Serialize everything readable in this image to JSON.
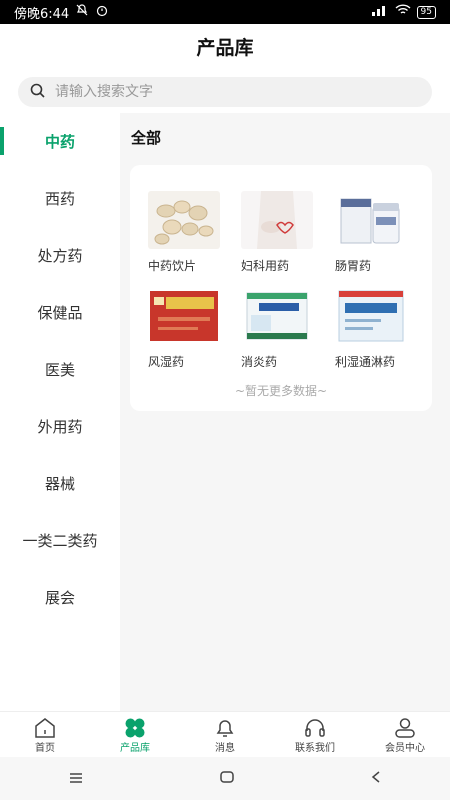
{
  "status_bar": {
    "time": "傍晚6:44",
    "network": "4G",
    "battery": "95"
  },
  "header": {
    "title": "产品库"
  },
  "search": {
    "placeholder": "请输入搜索文字"
  },
  "sidebar": {
    "items": [
      {
        "label": "中药",
        "active": true
      },
      {
        "label": "西药",
        "active": false
      },
      {
        "label": "处方药",
        "active": false
      },
      {
        "label": "保健品",
        "active": false
      },
      {
        "label": "医美",
        "active": false
      },
      {
        "label": "外用药",
        "active": false
      },
      {
        "label": "器械",
        "active": false
      },
      {
        "label": "一类二类药",
        "active": false
      },
      {
        "label": "展会",
        "active": false
      }
    ]
  },
  "main": {
    "section_title": "全部",
    "products": [
      {
        "label": "中药饮片"
      },
      {
        "label": "妇科用药"
      },
      {
        "label": "肠胃药"
      },
      {
        "label": "风湿药"
      },
      {
        "label": "消炎药"
      },
      {
        "label": "利湿通淋药"
      }
    ],
    "no_more": "~暂无更多数据~"
  },
  "tabbar": {
    "items": [
      {
        "label": "首页",
        "icon": "home-icon"
      },
      {
        "label": "产品库",
        "icon": "clover-icon",
        "active": true
      },
      {
        "label": "消息",
        "icon": "bell-icon"
      },
      {
        "label": "联系我们",
        "icon": "headset-icon"
      },
      {
        "label": "会员中心",
        "icon": "user-icon"
      }
    ]
  },
  "colors": {
    "accent": "#0aa26c"
  }
}
